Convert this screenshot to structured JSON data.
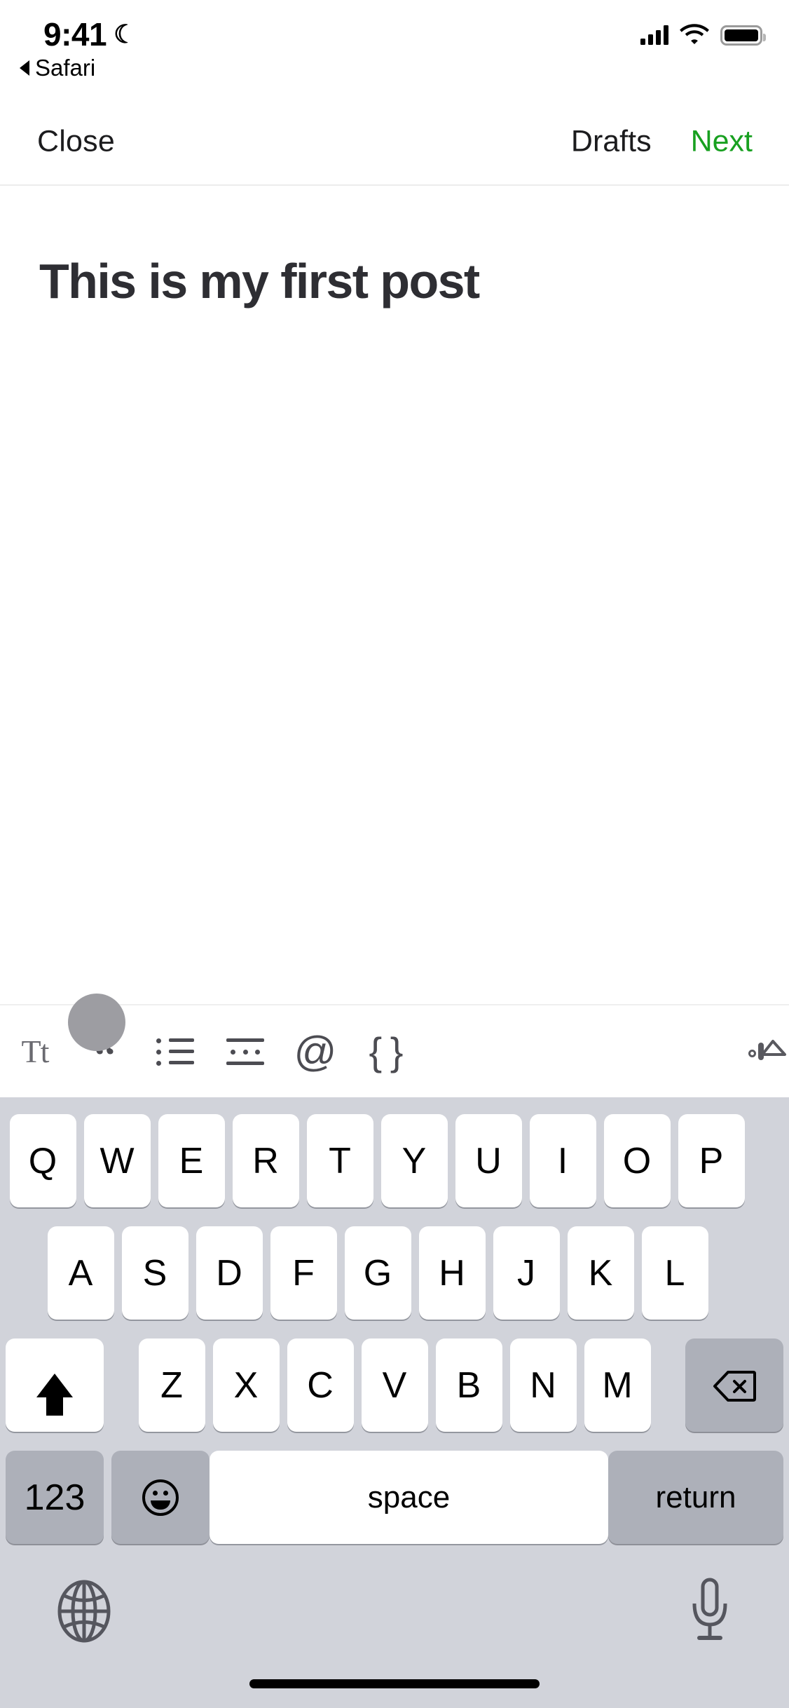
{
  "status_bar": {
    "time": "9:41",
    "moon_icon": "crescent-moon-icon",
    "signal_icon": "cellular-signal-icon",
    "wifi_icon": "wifi-icon",
    "battery_icon": "battery-full-icon",
    "back_app_label": "Safari",
    "back_chevron_icon": "back-triangle-icon"
  },
  "nav_bar": {
    "close_label": "Close",
    "drafts_label": "Drafts",
    "next_label": "Next",
    "next_color": "#18a020"
  },
  "editor": {
    "title_value": "This is my first post",
    "body_value": "",
    "body_placeholder": ""
  },
  "format_toolbar": {
    "items": [
      {
        "name": "text-format-icon",
        "glyph": "Tt"
      },
      {
        "name": "blockquote-icon",
        "glyph": "“"
      },
      {
        "name": "bulleted-list-icon",
        "glyph": "list"
      },
      {
        "name": "horizontal-rule-icon",
        "glyph": "hr"
      },
      {
        "name": "mention-icon",
        "glyph": "@"
      },
      {
        "name": "code-block-icon",
        "glyph": "{ }"
      }
    ],
    "image_button": {
      "name": "insert-image-icon",
      "glyph": "image"
    }
  },
  "touch_indicator": {
    "name": "touch-point",
    "visible": true
  },
  "keyboard": {
    "row1": [
      "Q",
      "W",
      "E",
      "R",
      "T",
      "Y",
      "U",
      "I",
      "O",
      "P"
    ],
    "row2": [
      "A",
      "S",
      "D",
      "F",
      "G",
      "H",
      "J",
      "K",
      "L"
    ],
    "row3_letters": [
      "Z",
      "X",
      "C",
      "V",
      "B",
      "N",
      "M"
    ],
    "shift_icon": "shift-up-arrow-icon",
    "delete_icon": "backspace-delete-icon",
    "numbers_label": "123",
    "emoji_icon": "emoji-smiley-icon",
    "space_label": "space",
    "return_label": "return",
    "globe_icon": "globe-language-icon",
    "mic_icon": "microphone-dictation-icon",
    "bg_color": "#d1d3da",
    "key_color": "#ffffff",
    "mod_key_color": "#adb0b9"
  },
  "home_indicator": {
    "name": "home-indicator"
  }
}
